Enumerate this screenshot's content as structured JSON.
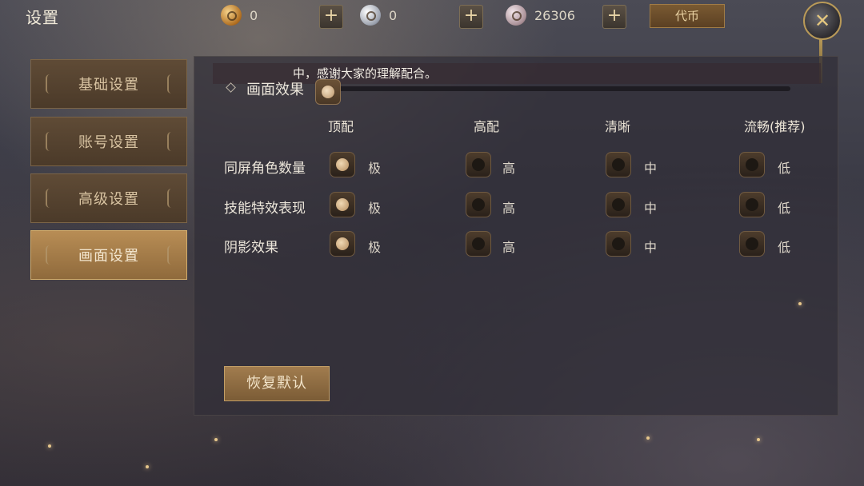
{
  "header": {
    "title": "设置"
  },
  "currencies": [
    {
      "icon": "gold-coin-icon",
      "value": "0"
    },
    {
      "icon": "silver-coin-icon",
      "value": "0"
    },
    {
      "icon": "bronze-coin-icon",
      "value": "26306"
    }
  ],
  "token_button": "代币",
  "plus_label": "+",
  "close_label": "✕",
  "sidebar": {
    "items": [
      {
        "label": "基础设置",
        "active": false
      },
      {
        "label": "账号设置",
        "active": false
      },
      {
        "label": "高级设置",
        "active": false
      },
      {
        "label": "画面设置",
        "active": true
      }
    ]
  },
  "notice": "中，感谢大家的理解配合。",
  "effect": {
    "label": "画面效果",
    "level": 0
  },
  "columns": [
    "顶配",
    "高配",
    "清晰",
    "流畅(推荐)"
  ],
  "rows": [
    {
      "label": "同屏角色数量",
      "options": [
        "极",
        "高",
        "中",
        "低"
      ],
      "selected": 0
    },
    {
      "label": "技能特效表现",
      "options": [
        "极",
        "高",
        "中",
        "低"
      ],
      "selected": 0
    },
    {
      "label": "阴影效果",
      "options": [
        "极",
        "高",
        "中",
        "低"
      ],
      "selected": 0
    }
  ],
  "reset_button": "恢复默认",
  "colors": {
    "accent": "#b88d55",
    "panel": "#302e38",
    "text": "#e8e2d6"
  }
}
